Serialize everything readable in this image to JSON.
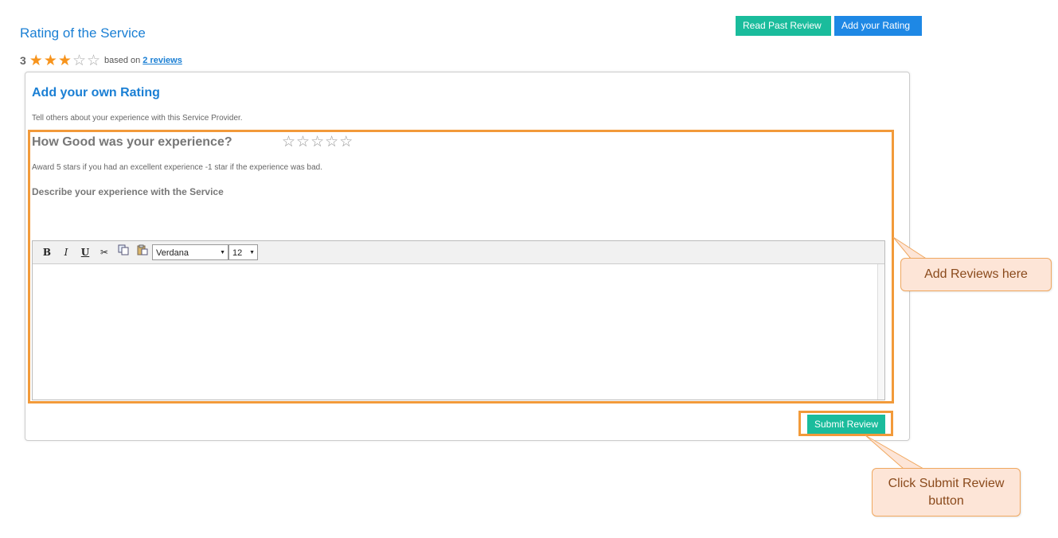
{
  "page_title": "Rating of the Service",
  "actions": {
    "read_past": "Read Past Review",
    "add_rating": "Add your Rating"
  },
  "summary": {
    "average": "3",
    "rating": 3,
    "max_rating": 5,
    "based_on": "based on",
    "reviews_link": "2 reviews"
  },
  "form": {
    "title": "Add your own Rating",
    "description": "Tell others about your experience with this Service Provider.",
    "question": "How Good was your experience?",
    "hint": "Award 5 stars if you had an excellent experience -1 star if the experience was bad.",
    "describe_label": "Describe your experience with the Service",
    "submit_label": "Submit Review"
  },
  "editor": {
    "bold": "B",
    "italic": "I",
    "underline": "U",
    "font": "Verdana",
    "size": "12"
  },
  "annotations": {
    "add_reviews": "Add Reviews here",
    "click_submit": "Click Submit Review button"
  },
  "colors": {
    "accent_blue": "#1a7fd4",
    "button_teal": "#1abc9c",
    "button_blue": "#1e88e5",
    "star_orange": "#f7941d",
    "highlight_orange": "#f29a3a",
    "callout_fill": "#fde5d7"
  }
}
